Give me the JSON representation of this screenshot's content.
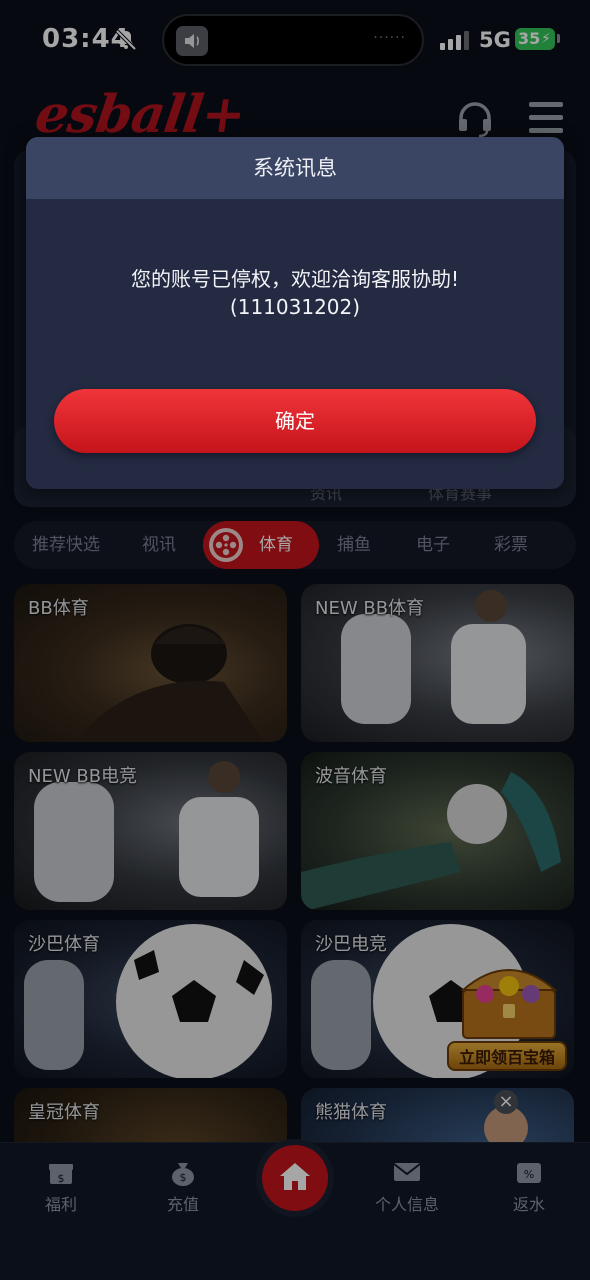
{
  "status_bar": {
    "time": "03:44",
    "network": "5G",
    "battery": "35",
    "mute_icon": "bell-slash-icon"
  },
  "header": {
    "logo": "esball+",
    "support_icon": "headset-icon",
    "menu_icon": "hamburger-menu-icon"
  },
  "background_panel": {
    "label1": "资讯",
    "label2": "体育赛事"
  },
  "tabs": [
    {
      "label": "推荐快选"
    },
    {
      "label": "视讯"
    },
    {
      "label": "体育",
      "active": true,
      "icon": "film-reel-icon"
    },
    {
      "label": "捕鱼"
    },
    {
      "label": "电子"
    },
    {
      "label": "彩票"
    }
  ],
  "games": [
    {
      "label": "BB体育"
    },
    {
      "label": "NEW BB体育"
    },
    {
      "label": "NEW BB电竞"
    },
    {
      "label": "波音体育"
    },
    {
      "label": "沙巴体育"
    },
    {
      "label": "沙巴电竞"
    },
    {
      "label": "皇冠体育"
    },
    {
      "label": "熊猫体育"
    }
  ],
  "treasure_badge": "立即领百宝箱",
  "bottom_nav": {
    "items": [
      {
        "label": "福利",
        "icon": "gift-icon"
      },
      {
        "label": "充值",
        "icon": "money-bag-icon"
      },
      {
        "label": "",
        "icon": "home-icon"
      },
      {
        "label": "个人信息",
        "icon": "envelope-icon"
      },
      {
        "label": "返水",
        "icon": "wallet-percent-icon"
      }
    ]
  },
  "dialog": {
    "title": "系统讯息",
    "message": "您的账号已停权，欢迎洽询客服协助!",
    "code": "(111031202)",
    "confirm_label": "确定"
  },
  "colors": {
    "accent": "#c3141c",
    "background": "#0b0f1a",
    "dialog_bg": "#232a41",
    "dialog_header": "#3a4564"
  }
}
